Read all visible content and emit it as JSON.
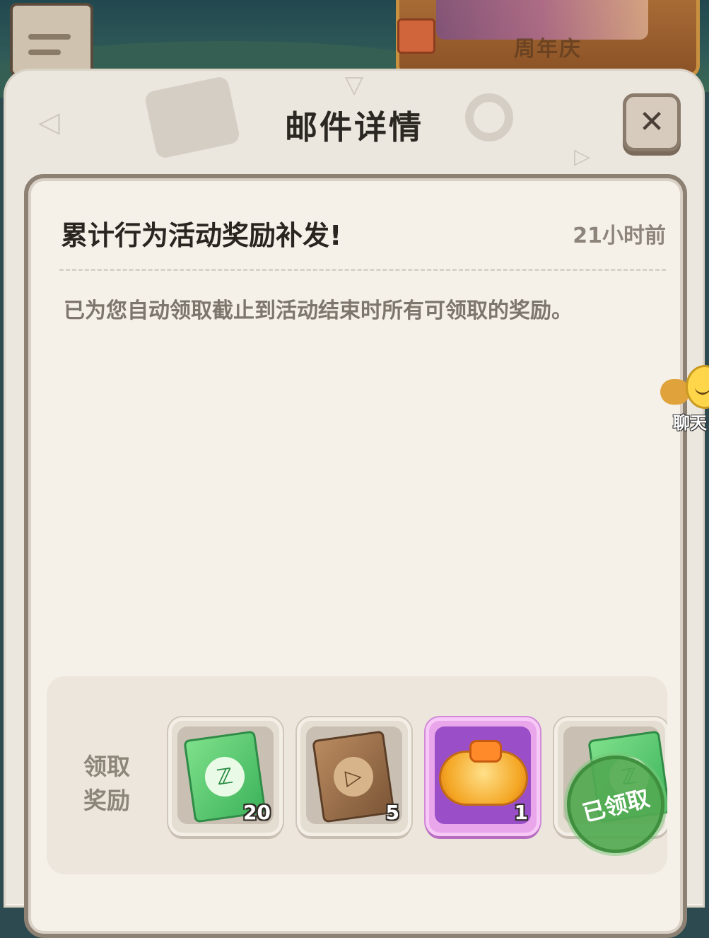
{
  "background": {
    "event_banner_label": "周年庆"
  },
  "dialog": {
    "title": "邮件详情",
    "close_icon": "close-x-icon"
  },
  "mail": {
    "subject": "累计行为活动奖励补发!",
    "time_ago": "21小时前",
    "body": "已为您自动领取截止到活动结束时所有可领取的奖励。"
  },
  "rewards": {
    "label": "领取奖励",
    "items": [
      {
        "icon": "green-ticket-icon",
        "count": "20"
      },
      {
        "icon": "brown-ticket-icon",
        "count": "5"
      },
      {
        "icon": "gold-bracelet-icon",
        "count": "1"
      },
      {
        "icon": "green-ticket-icon",
        "count": ""
      }
    ],
    "claimed_stamp": "已领取"
  },
  "chat": {
    "label": "聊天"
  },
  "colors": {
    "panel_bg": "#f5f0e8",
    "claimed_green": "#52aa52",
    "rare_purple": "#9a4fc8"
  }
}
